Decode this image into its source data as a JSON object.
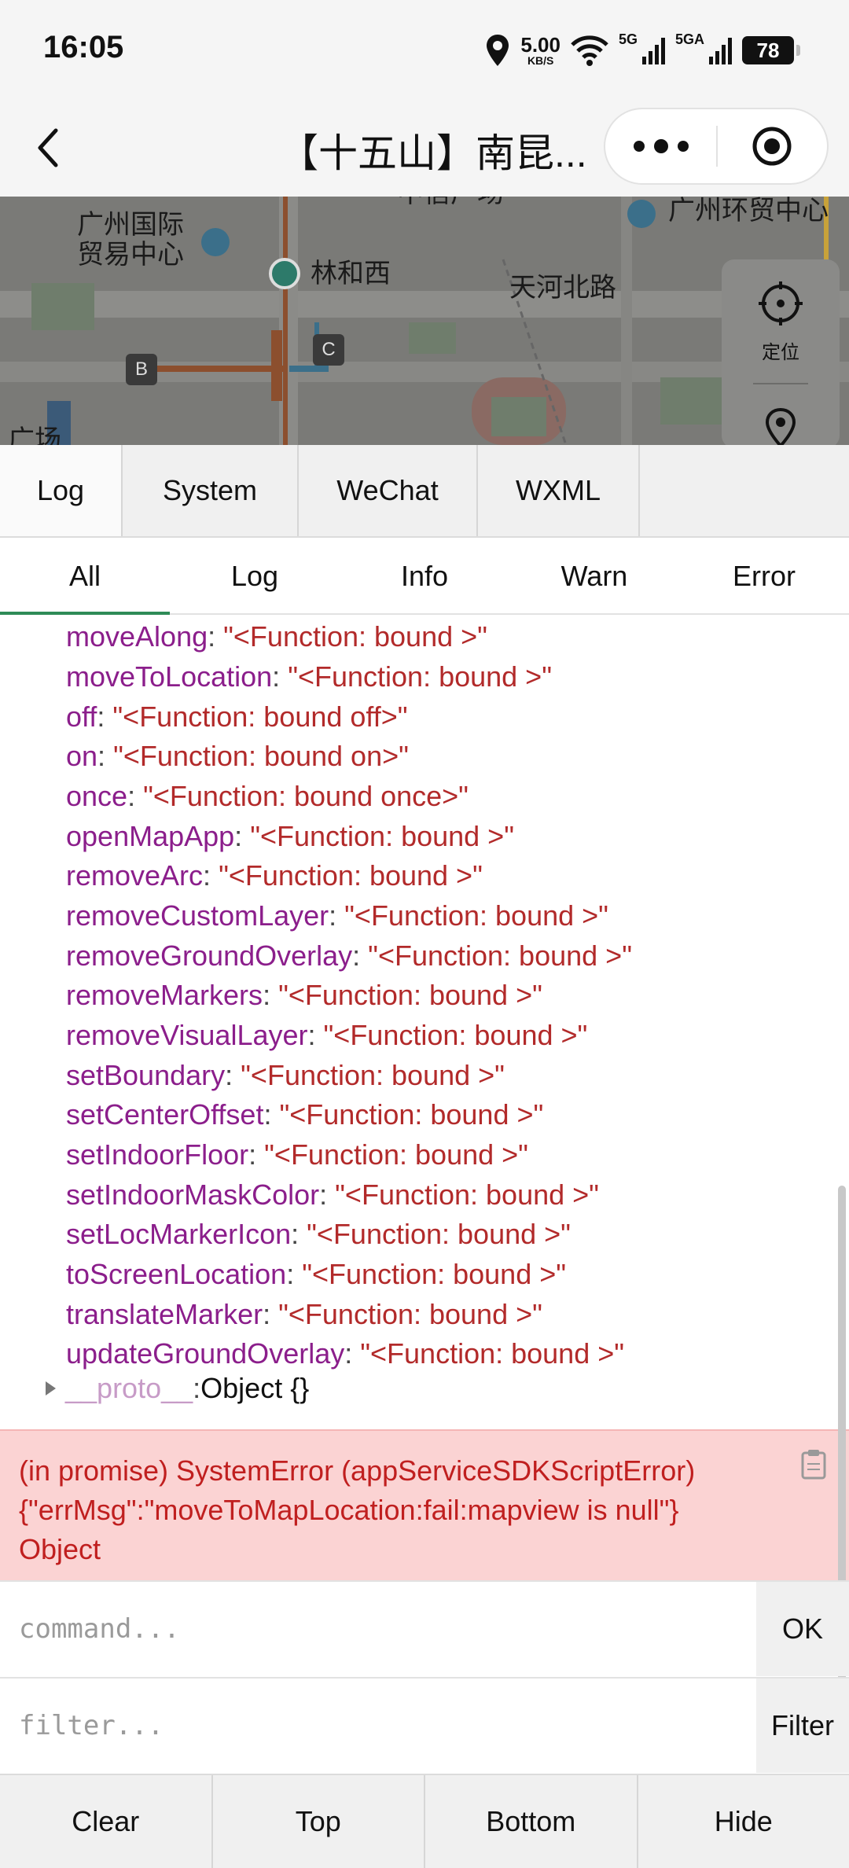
{
  "status_bar": {
    "time": "16:05",
    "net_speed": "5.00",
    "net_speed_unit": "KB/S",
    "signal1_label": "5G",
    "signal2_label": "5GA",
    "battery": "78"
  },
  "nav": {
    "title": "【十五山】南昆..."
  },
  "map": {
    "labels": [
      "广州国际",
      "贸易中心",
      "林和西",
      "天河北路",
      "广州环贸中心",
      "中信广场",
      "广场"
    ],
    "badge_b": "B",
    "badge_c": "C",
    "locate_label": "定位"
  },
  "tabs": [
    "Log",
    "System",
    "WeChat",
    "WXML"
  ],
  "filter_tabs": [
    "All",
    "Log",
    "Info",
    "Warn",
    "Error"
  ],
  "log": {
    "props": [
      {
        "key": "moveAlong",
        "val": "\"<Function: bound >\""
      },
      {
        "key": "moveToLocation",
        "val": "\"<Function: bound >\""
      },
      {
        "key": "off",
        "val": "\"<Function: bound off>\""
      },
      {
        "key": "on",
        "val": "\"<Function: bound on>\""
      },
      {
        "key": "once",
        "val": "\"<Function: bound once>\""
      },
      {
        "key": "openMapApp",
        "val": "\"<Function: bound >\""
      },
      {
        "key": "removeArc",
        "val": "\"<Function: bound >\""
      },
      {
        "key": "removeCustomLayer",
        "val": "\"<Function: bound >\""
      },
      {
        "key": "removeGroundOverlay",
        "val": "\"<Function: bound >\""
      },
      {
        "key": "removeMarkers",
        "val": "\"<Function: bound >\""
      },
      {
        "key": "removeVisualLayer",
        "val": "\"<Function: bound >\""
      },
      {
        "key": "setBoundary",
        "val": "\"<Function: bound >\""
      },
      {
        "key": "setCenterOffset",
        "val": "\"<Function: bound >\""
      },
      {
        "key": "setIndoorFloor",
        "val": "\"<Function: bound >\""
      },
      {
        "key": "setIndoorMaskColor",
        "val": "\"<Function: bound >\""
      },
      {
        "key": "setLocMarkerIcon",
        "val": "\"<Function: bound >\""
      },
      {
        "key": "toScreenLocation",
        "val": "\"<Function: bound >\""
      },
      {
        "key": "translateMarker",
        "val": "\"<Function: bound >\""
      },
      {
        "key": "updateGroundOverlay",
        "val": "\"<Function: bound >\""
      }
    ],
    "proto_key": "__proto__",
    "proto_val": "Object {}",
    "error_line1": "(in promise) SystemError (appServiceSDKScriptError)",
    "error_line2": "{\"errMsg\":\"moveToMapLocation:fail:mapview is null\"}",
    "error_line3": "Object"
  },
  "command": {
    "placeholder": "command...",
    "button": "OK"
  },
  "filter": {
    "placeholder": "filter...",
    "button": "Filter"
  },
  "bottom_bar": [
    "Clear",
    "Top",
    "Bottom",
    "Hide"
  ],
  "colors": {
    "key": "#8b1e8b",
    "value": "#b22a2a",
    "error_bg": "#fbd3d3",
    "error_text": "#c01f1f",
    "active_underline": "#2e8b57"
  }
}
